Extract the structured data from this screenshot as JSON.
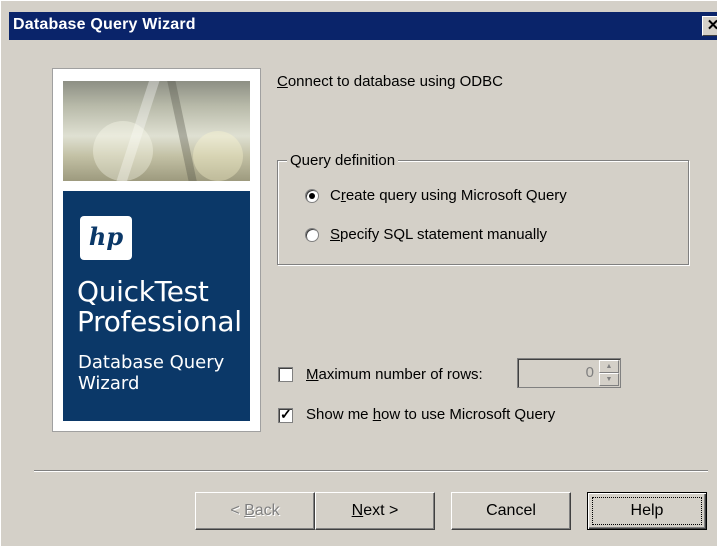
{
  "window": {
    "title": "Database Query Wizard",
    "close_glyph": "✕",
    "title_bar_color": "#0a246a"
  },
  "logo_panel": {
    "logo_text": "hp",
    "product_line1": "QuickTest",
    "product_line2": "Professional",
    "subtitle_line1": "Database Query",
    "subtitle_line2": "Wizard",
    "panel_color": "#0b3868"
  },
  "connection": {
    "label_prefix": "C",
    "label_rest": "onnect to database using  ODBC"
  },
  "query_definition": {
    "group_label": "Query definition",
    "options": [
      {
        "prefix": "C",
        "mnemonic": "r",
        "rest": "eate query using Microsoft Query",
        "selected": true
      },
      {
        "prefix": "",
        "mnemonic": "S",
        "rest": "pecify SQL statement manually",
        "selected": false
      }
    ]
  },
  "max_rows": {
    "prefix": "",
    "mnemonic": "M",
    "rest": "aximum number of rows:",
    "checked": false,
    "value": "0"
  },
  "show_me": {
    "prefix": "Show me ",
    "mnemonic": "h",
    "rest": "ow to use Microsoft Query",
    "checked": true
  },
  "buttons": {
    "back": {
      "prefix": "< ",
      "mnemonic": "B",
      "rest": "ack"
    },
    "next": {
      "prefix": "",
      "mnemonic": "N",
      "rest": "ext >"
    },
    "cancel": "Cancel",
    "help": "Help"
  }
}
